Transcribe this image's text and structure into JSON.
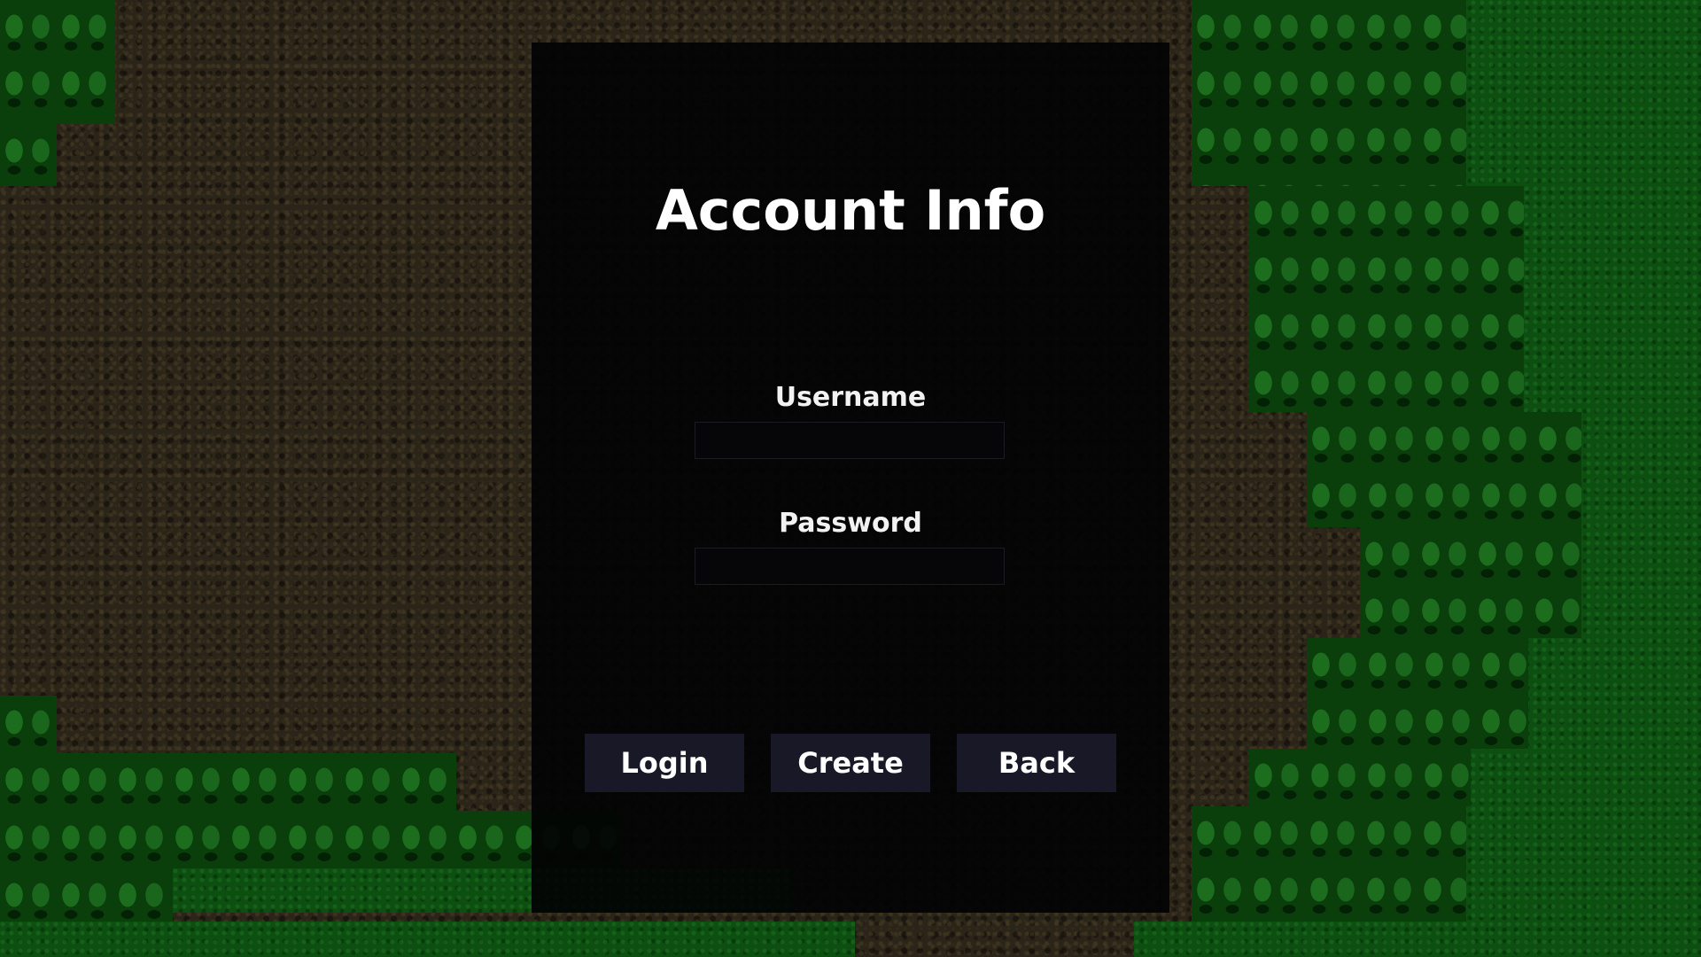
{
  "screen": {
    "title": "Account Info"
  },
  "form": {
    "username_label": "Username",
    "username_value": "",
    "password_label": "Password",
    "password_value": ""
  },
  "buttons": {
    "login_label": "Login",
    "create_label": "Create",
    "back_label": "Back"
  },
  "colors": {
    "panel_background": "#030304",
    "button_background": "#181826",
    "text": "#ffffff",
    "grass": "#0c4f10",
    "dirt": "#2b2519"
  }
}
